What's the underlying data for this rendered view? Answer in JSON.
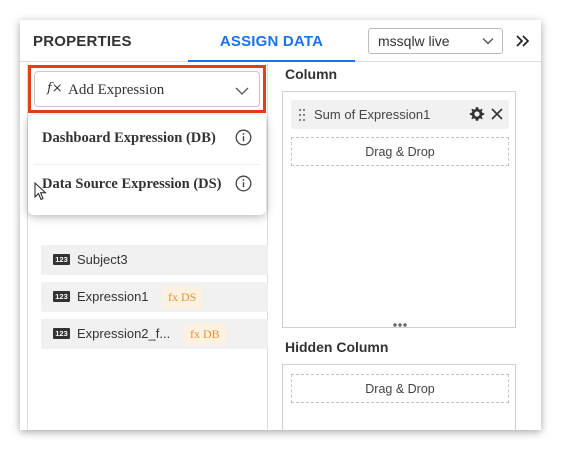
{
  "header": {
    "tabs": [
      {
        "label": "PROPERTIES",
        "active": false
      },
      {
        "label": "ASSIGN DATA",
        "active": true
      }
    ],
    "datasource_select": {
      "value": "mssqlw live",
      "icon": "chevron-down-icon"
    },
    "collapse_icon": "double-chevron-right-icon"
  },
  "left_panel": {
    "add_expression": {
      "icon_text": "f×",
      "label": "Add Expression",
      "icon": "chevron-down-icon",
      "highlight_color": "#e2401c"
    },
    "expression_menu": [
      {
        "label": "Dashboard Expression (DB)",
        "icon": "info-icon"
      },
      {
        "label": "Data Source Expression (DS)",
        "icon": "info-icon"
      }
    ],
    "fields": [
      {
        "type_badge": "123",
        "label": "Subject3",
        "expr_badge": ""
      },
      {
        "type_badge": "123",
        "label": "Expression1",
        "expr_badge": "fx DS"
      },
      {
        "type_badge": "123",
        "label": "Expression2_f...",
        "expr_badge": "fx DB"
      }
    ]
  },
  "right_panel": {
    "column": {
      "title": "Column",
      "chip": {
        "label": "Sum of Expression1",
        "icons": [
          "grip-icon",
          "gear-icon",
          "close-icon"
        ]
      },
      "drop_label": "Drag & Drop"
    },
    "hidden_column": {
      "title": "Hidden Column",
      "drop_label": "Drag & Drop"
    }
  },
  "colors": {
    "accent": "#1a73e8",
    "highlight": "#e2401c",
    "expr_badge_text": "#e6912f",
    "expr_badge_bg": "#fdf2e2"
  }
}
